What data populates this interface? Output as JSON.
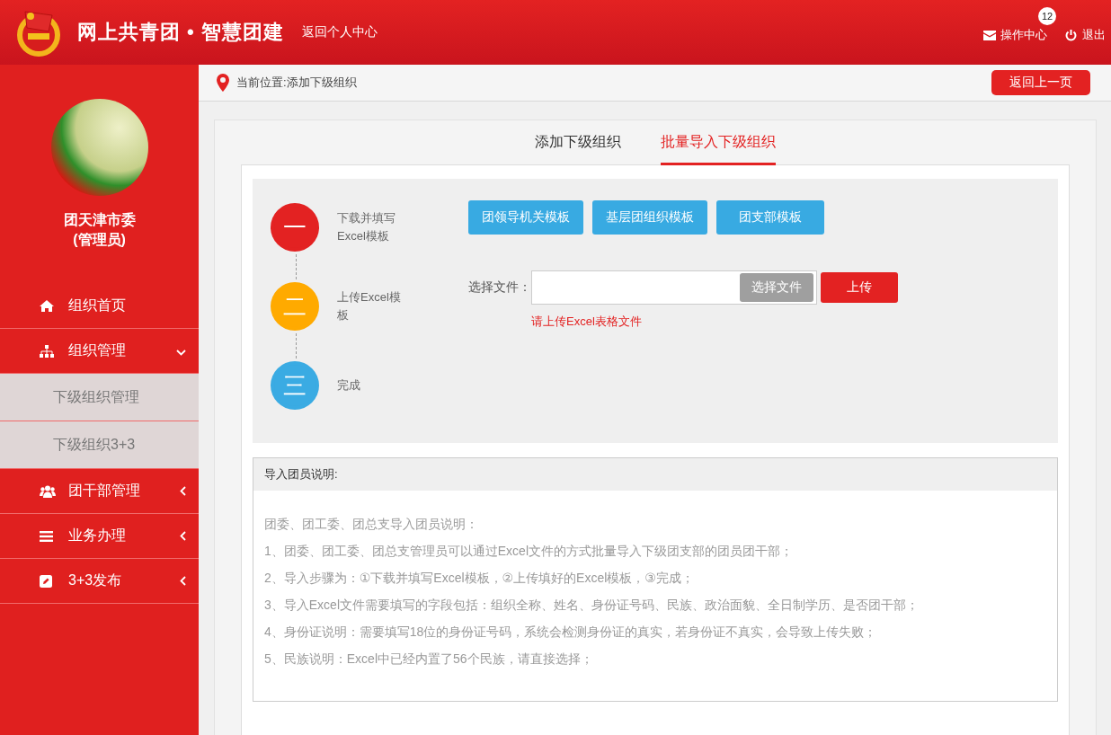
{
  "header": {
    "title": "网上共青团 • 智慧团建",
    "home_link": "返回个人中心",
    "ops_link": "操作中心",
    "ops_badge": "12",
    "logout_link": "退出"
  },
  "breadcrumb": {
    "location": "当前位置:添加下级组织",
    "back_button": "返回上一页"
  },
  "sidebar": {
    "user_name": "团天津市委",
    "user_role": "(管理员)",
    "items": [
      {
        "label": "组织首页",
        "kind": "link"
      },
      {
        "label": "组织管理",
        "kind": "group",
        "expanded": true,
        "children": [
          {
            "label": "下级组织管理"
          },
          {
            "label": "下级组织3+3"
          }
        ]
      },
      {
        "label": "团干部管理",
        "kind": "group",
        "expanded": false
      },
      {
        "label": "业务办理",
        "kind": "group",
        "expanded": false
      },
      {
        "label": "3+3发布",
        "kind": "group",
        "expanded": false
      }
    ]
  },
  "tabs": [
    {
      "label": "添加下级组织",
      "selected": false
    },
    {
      "label": "批量导入下级组织",
      "selected": true
    }
  ],
  "steps": [
    {
      "numeral": "一",
      "label": "下载并填写Excel模板",
      "color": "#e32222"
    },
    {
      "numeral": "二",
      "label": "上传Excel模板",
      "color": "#ffaa00"
    },
    {
      "numeral": "三",
      "label": "完成",
      "color": "#3aabe3"
    }
  ],
  "template_buttons": [
    "团领导机关模板",
    "基层团组织模板",
    "团支部模板"
  ],
  "upload": {
    "label": "选择文件：",
    "choose_button": "选择文件",
    "upload_button": "上传",
    "hint": "请上传Excel表格文件"
  },
  "notes": {
    "title": "导入团员说明:",
    "lines": [
      "团委、团工委、团总支导入团员说明：",
      "1、团委、团工委、团总支管理员可以通过Excel文件的方式批量导入下级团支部的团员团干部；",
      "2、导入步骤为：①下载并填写Excel模板，②上传填好的Excel模板，③完成；",
      "3、导入Excel文件需要填写的字段包括：组织全称、姓名、身份证号码、民族、政治面貌、全日制学历、是否团干部；",
      "4、身份证说明：需要填写18位的身份证号码，系统会检测身份证的真实，若身份证不真实，会导致上传失败；",
      "5、民族说明：Excel中已经内置了56个民族，请直接选择；"
    ]
  }
}
